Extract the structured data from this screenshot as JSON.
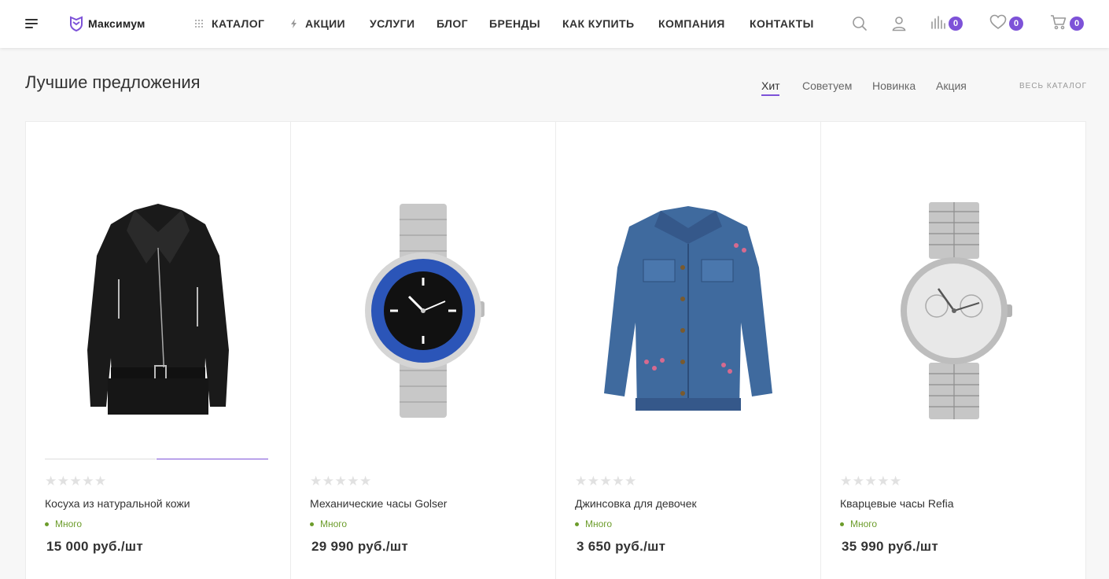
{
  "header": {
    "logo_text": "Максимум",
    "nav": [
      {
        "label": "КАТАЛОГ",
        "icon": "grid-dots-icon"
      },
      {
        "label": "АКЦИИ",
        "icon": "lightning-icon"
      },
      {
        "label": "УСЛУГИ"
      },
      {
        "label": "БЛОГ"
      },
      {
        "label": "БРЕНДЫ"
      },
      {
        "label": "КАК КУПИТЬ"
      },
      {
        "label": "КОМПАНИЯ"
      },
      {
        "label": "КОНТАКТЫ"
      }
    ],
    "compare_count": "0",
    "favorites_count": "0",
    "cart_count": "0"
  },
  "section": {
    "title": "Лучшие предложения",
    "tabs": [
      "Хит",
      "Советуем",
      "Новинка",
      "Акция"
    ],
    "active_tab": "Хит",
    "all_catalog": "ВЕСЬ КАТАЛОГ"
  },
  "products": [
    {
      "name": "Косуха из натуральной кожи",
      "stock": "Много",
      "price": "15 000 руб./шт",
      "image": "leather-jacket"
    },
    {
      "name": "Механические часы Golser",
      "stock": "Много",
      "price": "29 990 руб./шт",
      "image": "dive-watch"
    },
    {
      "name": "Джинсовка для девочек",
      "stock": "Много",
      "price": "3 650 руб./шт",
      "image": "denim-jacket"
    },
    {
      "name": "Кварцевые часы Refia",
      "stock": "Много",
      "price": "35 990 руб./шт",
      "image": "chrono-watch"
    }
  ],
  "colors": {
    "accent": "#7d52d8",
    "stock": "#6c9c2b",
    "stars_empty": "#e1e1e1"
  }
}
